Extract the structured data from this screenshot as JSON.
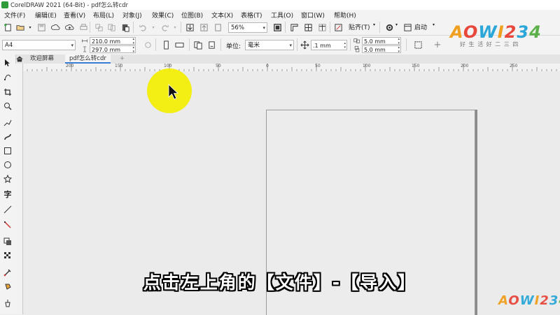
{
  "window": {
    "title": "CorelDRAW 2021 (64-Bit) - pdf怎么转cdr"
  },
  "menu": [
    "文件(F)",
    "编辑(E)",
    "查看(V)",
    "布局(L)",
    "对象(J)",
    "效果(C)",
    "位图(B)",
    "文本(X)",
    "表格(T)",
    "工具(O)",
    "窗口(W)",
    "帮助(H)"
  ],
  "toolbar": {
    "zoom": "56%",
    "snap_label": "贴齐(T)",
    "launch_label": "启动"
  },
  "propbar": {
    "page_size": "A4",
    "width": "210.0 mm",
    "height": "297.0 mm",
    "unit_label": "单位:",
    "unit_value": "毫米",
    "nudge": ".1 mm",
    "dup_x": "5.0 mm",
    "dup_y": "5.0 mm"
  },
  "tabs": [
    {
      "label": "欢迎屏幕"
    },
    {
      "label": "pdf怎么转cdr"
    },
    {
      "label": "+"
    }
  ],
  "ruler_labels": [
    "200",
    "150",
    "100",
    "50",
    "0",
    "50",
    "100",
    "150",
    "200",
    "250"
  ],
  "subtitle": "点击左上角的【文件】-【导入】",
  "brand": {
    "name": "AOWI234",
    "slogan": "好 生 活 好 二 三 四",
    "accent": "#f0a020",
    "accent2": "#e8473c",
    "accent3": "#2aa7d8"
  }
}
